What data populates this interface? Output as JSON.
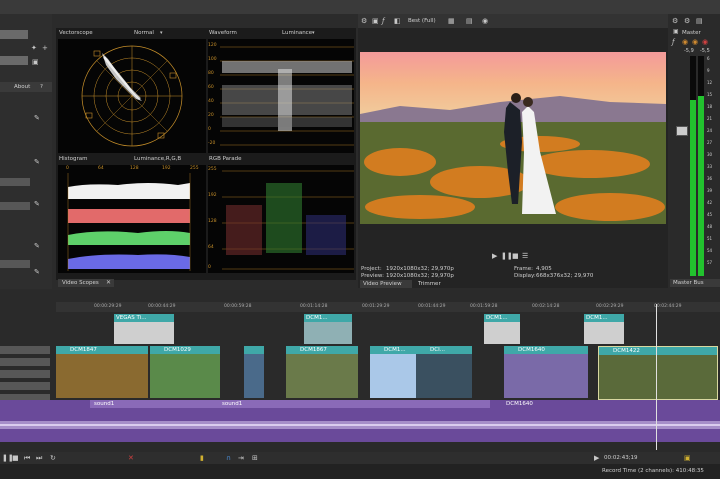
{
  "scopes": {
    "vectorscope": {
      "title": "Vectorscope",
      "mode": "Normal"
    },
    "waveform": {
      "title": "Waveform",
      "mode": "Luminance",
      "axis": [
        "120",
        "100",
        "80",
        "60",
        "40",
        "20",
        "0",
        "-20"
      ]
    },
    "histogram": {
      "title": "Histogram",
      "mode": "Luminance,R,G,B",
      "ticks": [
        "0",
        "64",
        "128",
        "192",
        "255"
      ]
    },
    "rgb_parade": {
      "title": "RGB Parade",
      "axis": [
        "255",
        "192",
        "128",
        "64",
        "0"
      ]
    },
    "tab_label": "Video Scopes"
  },
  "left_panel": {
    "about_label": "About",
    "help_label": "?"
  },
  "preview": {
    "quality": "Best (Full)",
    "project_label": "Project:",
    "project_value": "1920x1080x32; 29,970p",
    "preview_label": "Preview:",
    "preview_value": "1920x1080x32; 29,970p",
    "frame_label": "Frame:",
    "frame_value": "4,905",
    "display_label": "Display:",
    "display_value": "668x376x32; 29,970",
    "tab_label": "Video Preview",
    "trimmer_label": "Trimmer"
  },
  "master": {
    "title": "Master",
    "db_left": "-5,9",
    "db_right": "-5,5",
    "scale": [
      "6",
      "9",
      "12",
      "15",
      "18",
      "21",
      "24",
      "27",
      "30",
      "33",
      "36",
      "39",
      "42",
      "45",
      "48",
      "51",
      "54",
      "57"
    ],
    "bus_label": "Master Bus"
  },
  "timeline": {
    "ruler": [
      "00:00:29:29",
      "00:00:44:29",
      "00:00:59:28",
      "00:01:14:28",
      "00:01:29:29",
      "00:01:44:29",
      "00:01:59:28",
      "00:02:14:28",
      "00:02:29:29",
      "00:02:44:29"
    ],
    "overlay_clips": [
      "VEGAS Ti...",
      "DCM1...",
      "DCM1...",
      "DCM1..."
    ],
    "video_clips": [
      "DCM1847",
      "DCM1029",
      "DCM1867",
      "DCM1...",
      "DCI...",
      "DCM1640",
      "DCM1422"
    ],
    "audio_clips": [
      "sound1",
      "sound1",
      "DCM1640"
    ],
    "timecode": "00:02:43;19",
    "record_time": "Record Time (2 channels): 410:48:35"
  },
  "colors": {
    "teal": "#3fa8a8",
    "purple": "#6a4a9a",
    "meter": "#22c22e"
  }
}
